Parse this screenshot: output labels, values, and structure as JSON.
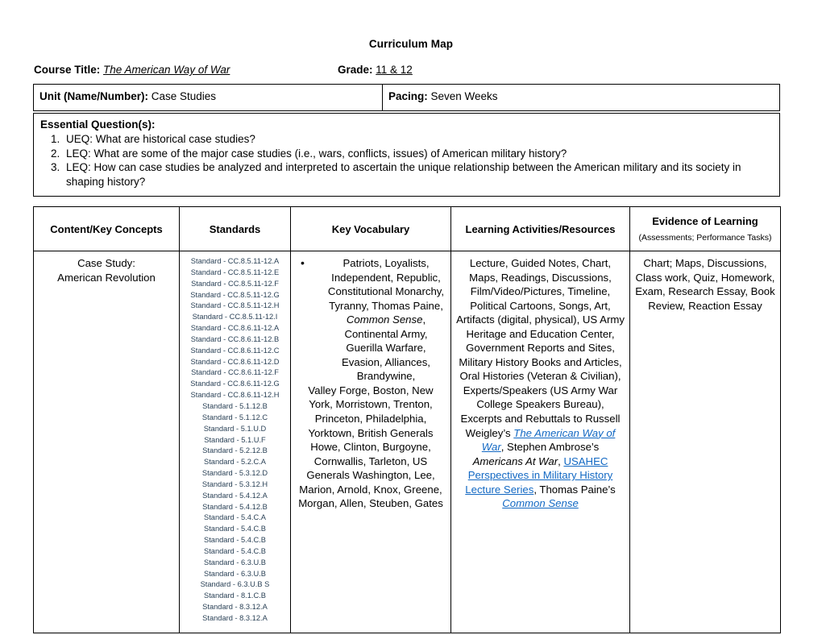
{
  "document": {
    "title": "Curriculum Map"
  },
  "course_line": {
    "course_title_label": "Course Title:",
    "course_title_value": "The American Way of War",
    "grade_label": "Grade:",
    "grade_value": "11 & 12"
  },
  "unit_row": {
    "unit_label": "Unit (Name/Number):",
    "unit_value": " Case Studies",
    "pacing_label": "Pacing:",
    "pacing_value": "  Seven Weeks"
  },
  "essential_questions": {
    "heading": "Essential Question(s):",
    "items": [
      "UEQ: What are historical case studies?",
      "LEQ: What are some of the major case studies (i.e., wars, conflicts, issues) of American military history?",
      "LEQ: How can case studies be analyzed and interpreted to ascertain the unique relationship between the American military and its society in shaping history?"
    ]
  },
  "main_table": {
    "headers": {
      "content": "Content/Key Concepts",
      "standards": "Standards",
      "vocabulary": "Key Vocabulary",
      "learning": "Learning Activities/Resources",
      "evidence_main": "Evidence of Learning",
      "evidence_sub": "(Assessments; Performance Tasks)"
    },
    "row": {
      "content_line1": "Case Study:",
      "content_line2": "American Revolution",
      "standards": [
        "Standard - CC.8.5.11-12.A",
        "Standard - CC.8.5.11-12.E",
        "Standard - CC.8.5.11-12.F",
        "Standard - CC.8.5.11-12.G",
        "Standard - CC.8.5.11-12.H",
        "Standard - CC.8.5.11-12.I",
        "Standard - CC.8.6.11-12.A",
        "Standard - CC.8.6.11-12.B",
        "Standard - CC.8.6.11-12.C",
        "Standard - CC.8.6.11-12.D",
        "Standard - CC.8.6.11-12.F",
        "Standard - CC.8.6.11-12.G",
        "Standard - CC.8.6.11-12.H",
        "Standard - 5.1.12.B",
        "Standard - 5.1.12.C",
        "Standard - 5.1.U.D",
        "Standard - 5.1.U.F",
        "Standard - 5.2.12.B",
        "Standard - 5.2.C.A",
        "Standard - 5.3.12.D",
        "Standard - 5.3.12.H",
        "Standard - 5.4.12.A",
        "Standard - 5.4.12.B",
        "Standard - 5.4.C.A",
        "Standard - 5.4.C.B",
        "Standard - 5.4.C.B",
        "Standard - 5.4.C.B",
        "Standard - 6.3.U.B",
        "Standard - 6.3.U.B",
        "Standard - 6.3.U.B S",
        "Standard - 8.1.C.B",
        "Standard - 8.3.12.A",
        "Standard - 8.3.12.A"
      ],
      "vocabulary": {
        "part1": "Patriots, Loyalists, Independent, Republic, Constitutional Monarchy, Tyranny, Thomas Paine, ",
        "italic1": "Common Sense",
        "part2": ", Continental Army, Guerilla Warfare, Evasion, Alliances, Brandywine,",
        "part3": "Valley Forge, Boston, New York, Morristown, Trenton, Princeton, Philadelphia, Yorktown, British Generals Howe, Clinton, Burgoyne, Cornwallis, Tarleton, US Generals Washington, Lee, Marion, Arnold, Knox, Greene, Morgan, Allen, Steuben, Gates"
      },
      "learning": {
        "part1": "Lecture, Guided Notes, Chart, Maps, Readings, Discussions, Film/Video/Pictures, Timeline, Political Cartoons, Songs, Art, Artifacts (digital, physical), US Army Heritage and Education Center, Government Reports and Sites, Military History Books and Articles, Oral Histories (Veteran & Civilian), Experts/Speakers (US Army War College Speakers Bureau), Excerpts and Rebuttals to Russell Weigley’s ",
        "link1": "The American Way of War",
        "part2": ", Stephen Ambrose’s ",
        "italic1": "Americans At War",
        "part3": ", ",
        "link2": "USAHEC Perspectives in Military History Lecture Series",
        "part4": ", Thomas Paine’s ",
        "link3": "Common Sense"
      },
      "evidence": "Chart; Maps, Discussions, Class work, Quiz, Homework, Exam, Research Essay, Book Review, Reaction Essay"
    }
  },
  "colors": {
    "link": "#1268c3",
    "standards_text": "#2b4257",
    "border": "#000000"
  }
}
